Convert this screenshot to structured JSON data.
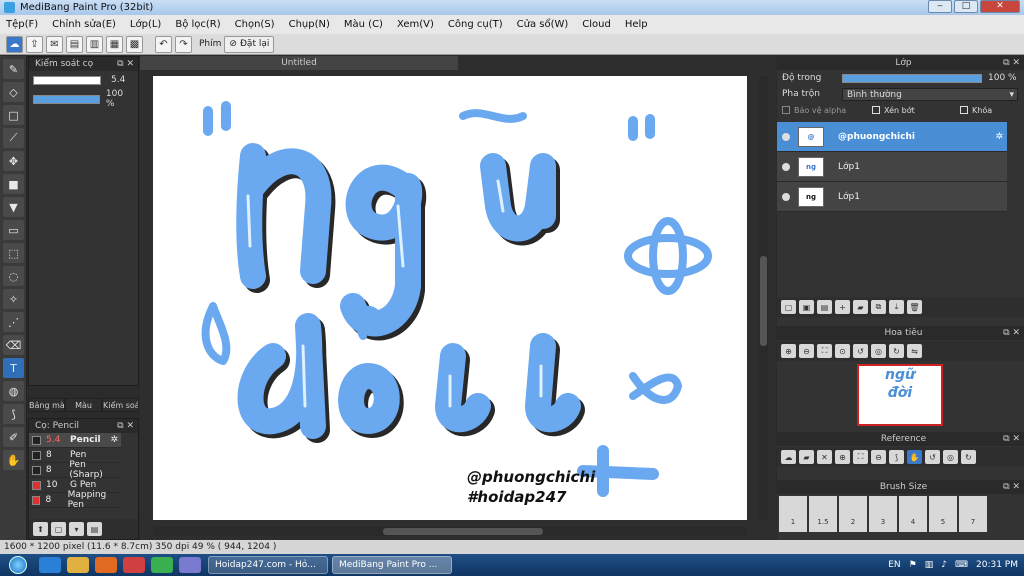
{
  "window": {
    "title": "MediBang Paint Pro (32bit)",
    "minimize": "‒",
    "maximize": "□",
    "close": "✕"
  },
  "menu": [
    "Tệp(F)",
    "Chỉnh sửa(E)",
    "Lớp(L)",
    "Bộ lọc(R)",
    "Chọn(S)",
    "Chụp(N)",
    "Màu (C)",
    "Xem(V)",
    "Công cụ(T)",
    "Cửa sổ(W)",
    "Cloud",
    "Help"
  ],
  "toolbar": {
    "finger_label": "Phím",
    "reset_label": "Đặt lại"
  },
  "brush_control": {
    "title": "Kiểm soát cọ",
    "size_value": "5.4",
    "opacity_value": "100 %",
    "opacity": 1.0,
    "size_fraction": 0.02
  },
  "left_tabs": [
    "Bảng màu",
    "Màu",
    "Kiểm soát cọ"
  ],
  "brush_panel": {
    "title": "Cọ: Pencil",
    "items": [
      {
        "size": "5.4",
        "name": "Pencil",
        "color": "#222222",
        "selected": true
      },
      {
        "size": "8",
        "name": "Pen",
        "color": "#222222"
      },
      {
        "size": "8",
        "name": "Pen (Sharp)",
        "color": "#222222"
      },
      {
        "size": "10",
        "name": "G Pen",
        "color": "#e03030"
      },
      {
        "size": "8",
        "name": "Mapping Pen",
        "color": "#e03030"
      }
    ]
  },
  "canvas": {
    "tab_title": "Untitled",
    "watermark1": "@phuongchichi",
    "watermark2": "#hoidap247"
  },
  "layers": {
    "title": "Lớp",
    "opacity_label": "Độ trong",
    "opacity_value": "100 %",
    "blend_label": "Pha trộn",
    "blend_value": "Bình thường",
    "check_alpha": "Bảo vệ alpha",
    "check_clip": "Xén bớt",
    "check_lock": "Khóa",
    "items": [
      {
        "name": "@phuongchichi",
        "selected": true
      },
      {
        "name": "Lớp1"
      },
      {
        "name": "Lớp1"
      }
    ]
  },
  "navigator": {
    "title": "Hoa tiêu"
  },
  "reference": {
    "title": "Reference"
  },
  "brush_size": {
    "title": "Brush Size",
    "sizes": [
      "1",
      "1.5",
      "2",
      "3",
      "4",
      "5",
      "7"
    ]
  },
  "status": {
    "text": "1600 * 1200 pixel   (11.6 * 8.7cm)   350 dpi   49 %   ( 944, 1204 )"
  },
  "taskbar": {
    "tasks": [
      "Hoidap247.com - Hỏ...",
      "MediBang Paint Pro ..."
    ],
    "lang": "EN",
    "time": "20:31 PM"
  },
  "colors": {
    "accent": "#4a8fd6",
    "lettering": "#6aa8f0"
  }
}
